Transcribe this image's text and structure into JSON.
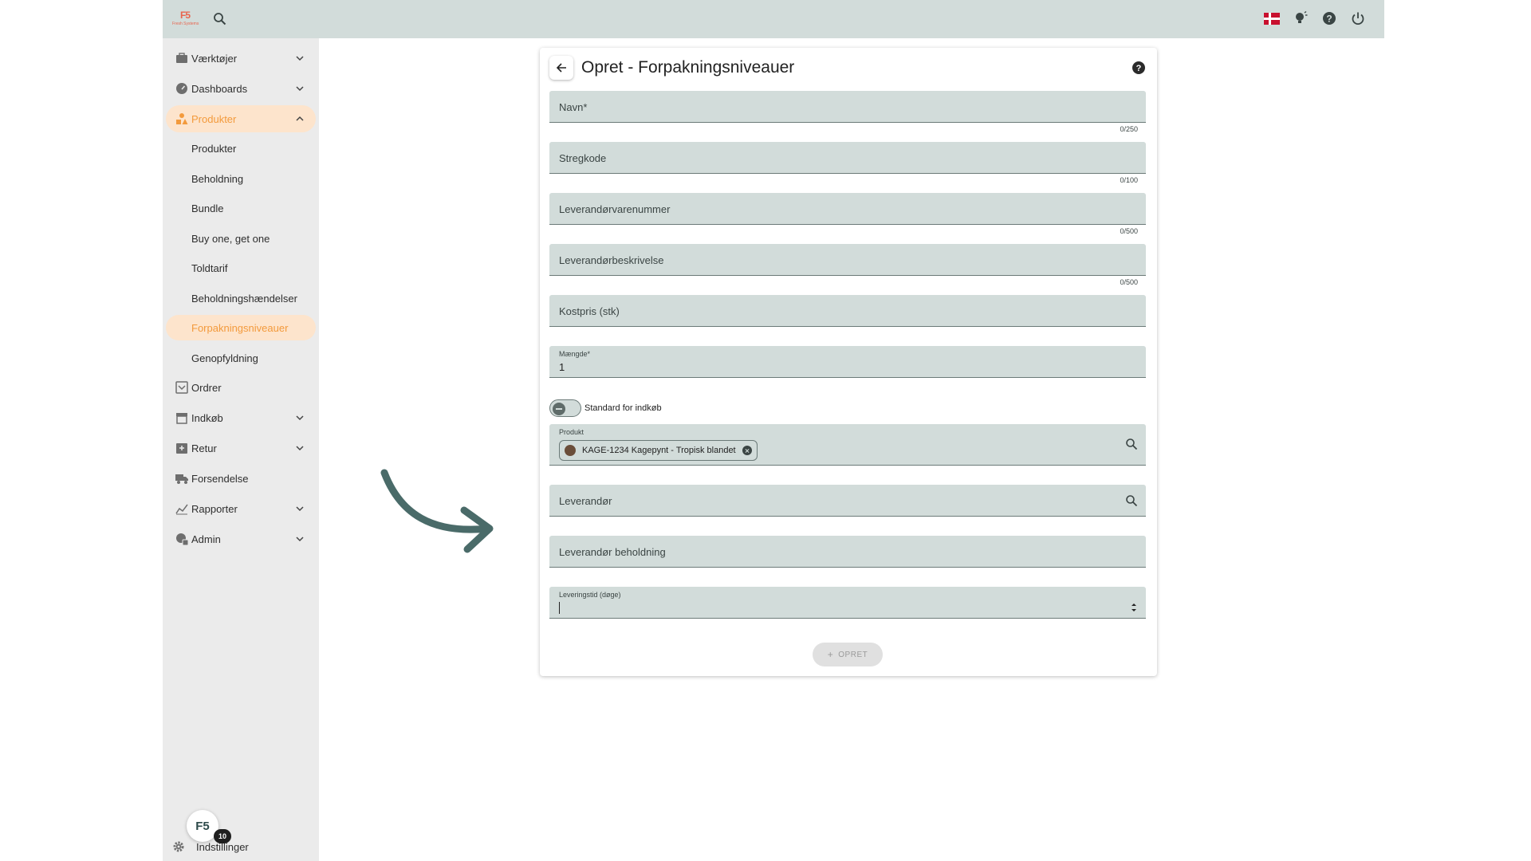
{
  "app": {
    "logo_text": "F5",
    "logo_sub": "Fresh Systems"
  },
  "topbar": {
    "icons": [
      "search-icon",
      "danish-flag-icon",
      "lightbulb-icon",
      "help-icon",
      "power-icon"
    ]
  },
  "sidebar": {
    "items": [
      {
        "label": "Værktøjer",
        "icon": "toolbox-icon",
        "expandable": true
      },
      {
        "label": "Dashboards",
        "icon": "gauge-icon",
        "expandable": true
      },
      {
        "label": "Produkter",
        "icon": "products-icon",
        "expandable": true,
        "active": true
      },
      {
        "label": "Ordrer",
        "icon": "orders-icon",
        "expandable": false
      },
      {
        "label": "Indkøb",
        "icon": "store-icon",
        "expandable": true
      },
      {
        "label": "Retur",
        "icon": "return-icon",
        "expandable": true
      },
      {
        "label": "Forsendelse",
        "icon": "truck-icon",
        "expandable": false
      },
      {
        "label": "Rapporter",
        "icon": "chart-icon",
        "expandable": true
      },
      {
        "label": "Admin",
        "icon": "admin-icon",
        "expandable": true
      }
    ],
    "sub_items": [
      "Produkter",
      "Beholdning",
      "Bundle",
      "Buy one, get one",
      "Toldtarif",
      "Beholdningshændelser",
      "Forpakningsniveauer",
      "Genopfyldning"
    ],
    "active_sub": "Forpakningsniveauer",
    "badge_logo": "F5",
    "badge_count": "10",
    "settings_label": "Indstillinger"
  },
  "form": {
    "title": "Opret - Forpakningsniveauer",
    "fields": {
      "navn": {
        "label": "Navn*",
        "counter": "0/250"
      },
      "stregkode": {
        "label": "Stregkode",
        "counter": "0/100"
      },
      "leverandoervarenummer": {
        "label": "Leverandørvarenummer",
        "counter": "0/500"
      },
      "leverandoerbeskrivelse": {
        "label": "Leverandørbeskrivelse",
        "counter": "0/500"
      },
      "kostpris": {
        "label": "Kostpris (stk)"
      },
      "maengde": {
        "label": "Mængde*",
        "value": "1"
      },
      "produkt": {
        "label": "Produkt",
        "chip": "KAGE-1234 Kagepynt - Tropisk blandet"
      },
      "leverandoer": {
        "label": "Leverandør"
      },
      "leverandoer_beholdning": {
        "label": "Leverandør beholdning"
      },
      "leveringstid": {
        "label": "Leveringstid (døge)"
      }
    },
    "toggle_label": "Standard for indkøb",
    "toggle_on": false,
    "submit_label": "OPRET"
  },
  "colors": {
    "topbar": "#d2dcda",
    "sidebar": "#ebebeb",
    "active_accent": "#f39a3c",
    "active_bg": "#fde4cc",
    "field_bg": "#d2dcda",
    "arrow": "#4a6b69"
  }
}
